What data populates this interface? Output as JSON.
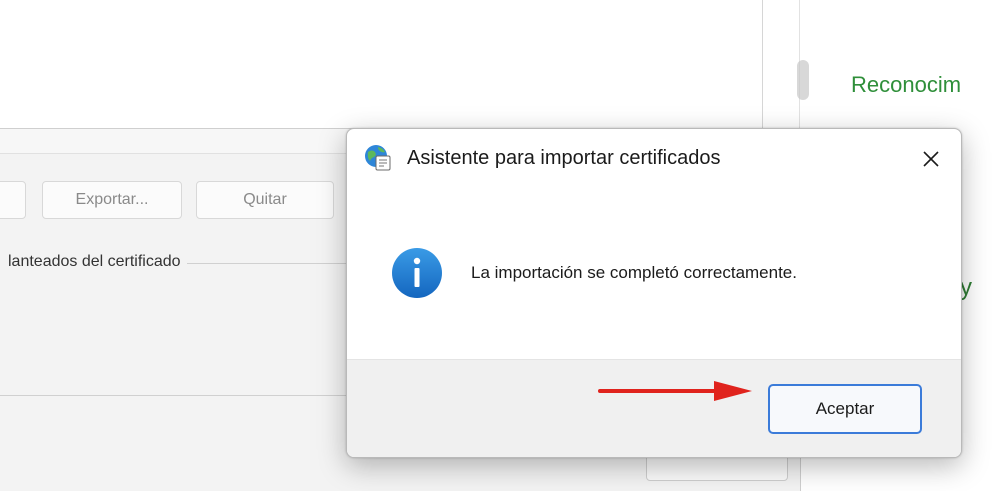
{
  "background_right": {
    "heading_fragment": "Reconocim",
    "text_fragment": "o y"
  },
  "background_left": {
    "buttons": {
      "export_label": "Exportar...",
      "remove_label": "Quitar"
    },
    "group_label": "lanteados del certificado"
  },
  "dialog": {
    "title": "Asistente para importar certificados",
    "message": "La importación se completó correctamente.",
    "ok_label": "Aceptar",
    "icons": {
      "app": "certificate-globe-icon",
      "info": "info-icon",
      "close": "close-icon"
    }
  },
  "annotation": {
    "arrow_color": "#e0231d"
  },
  "colors": {
    "accent": "#3b7bd9",
    "info_blue": "#1a7fd4",
    "green_text": "#2f8f3a"
  }
}
